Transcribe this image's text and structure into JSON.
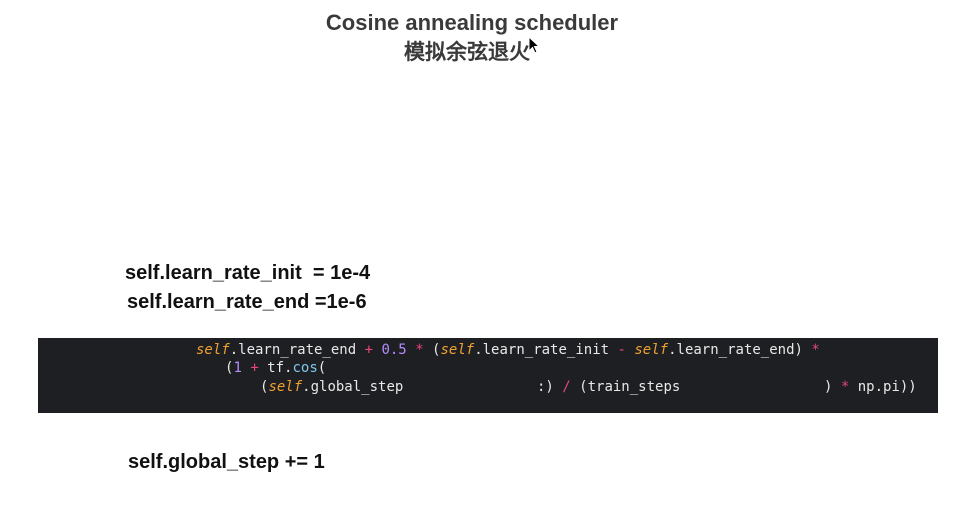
{
  "title": "Cosine annealing scheduler",
  "subtitle": "模拟余弦退火",
  "params": {
    "init": "self.learn_rate_init  = 1e-4",
    "end": "self.learn_rate_end =1e-6"
  },
  "code": {
    "line1": {
      "self1": "self",
      "t1": ".learn_rate_end ",
      "plus": "+",
      "sp1": " ",
      "half": "0.5",
      "sp2": " ",
      "mul1": "*",
      "t2": " (",
      "self2": "self",
      "t3": ".learn_rate_init ",
      "minus": "-",
      "sp3": " ",
      "self3": "self",
      "t4": ".learn_rate_end) ",
      "mul2": "*"
    },
    "line2": {
      "t1": "(",
      "one": "1",
      "sp1": " ",
      "plus": "+",
      "t2": " tf.",
      "cos": "cos",
      "t3": "("
    },
    "line3": {
      "t1": "(",
      "self1": "self",
      "t2": ".global_step",
      "t3": ":)",
      "sp1": " ",
      "div": "/",
      "t4": " (train_steps",
      "t5": ") ",
      "mul": "*",
      "t6": " np.pi))"
    }
  },
  "step": "self.global_step += 1",
  "icons": {
    "cursor": "mouse-pointer-icon"
  }
}
